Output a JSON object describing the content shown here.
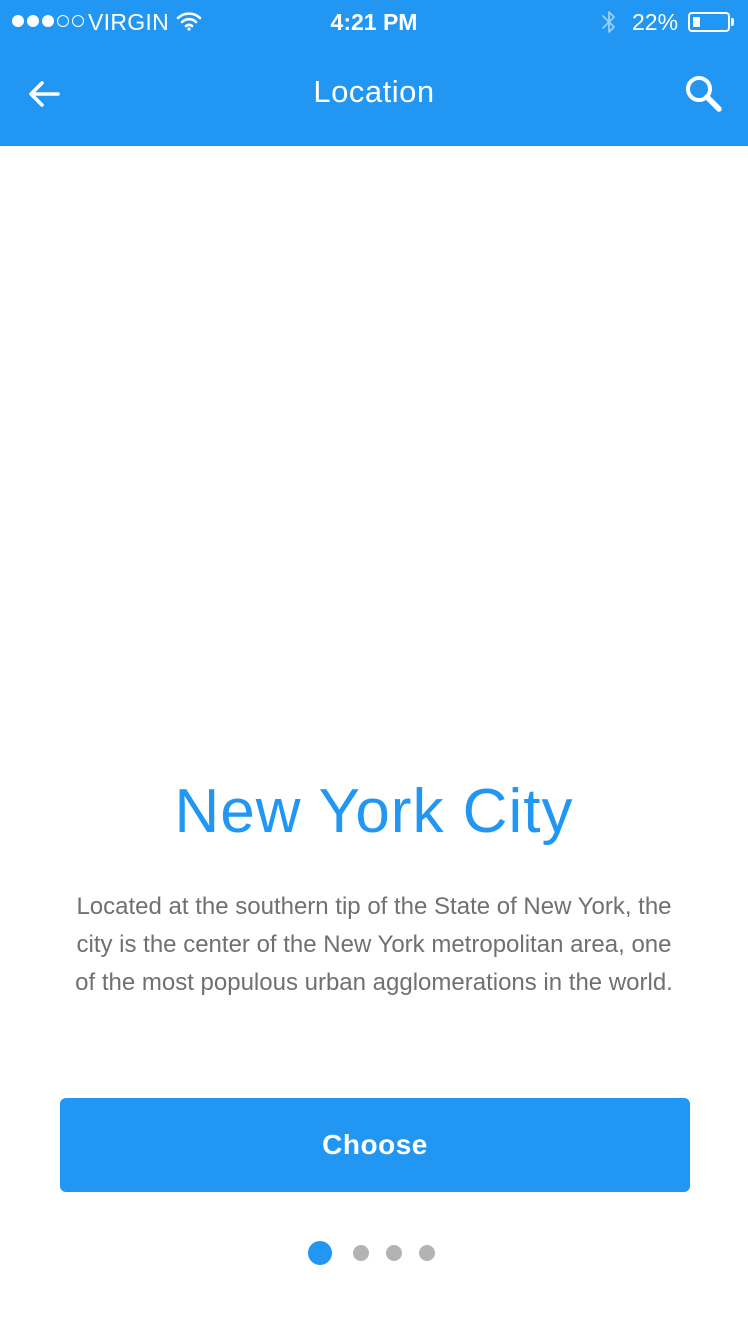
{
  "status_bar": {
    "carrier": "VIRGIN",
    "time": "4:21 PM",
    "battery_percent": "22%",
    "battery_level": 0.22,
    "signal_bars_filled": 3,
    "signal_bars_total": 5,
    "icons": [
      "wifi-icon",
      "bluetooth-icon",
      "battery-icon"
    ]
  },
  "nav": {
    "title": "Location",
    "back_icon": "arrow-left-icon",
    "search_icon": "search-icon"
  },
  "location": {
    "name": "New York City",
    "description": "Located at the southern tip of the State of New York, the city is the center of the New York metropolitan area, one of the most populous urban agglomerations in the world."
  },
  "actions": {
    "choose_label": "Choose"
  },
  "pager": {
    "total_pages": 4,
    "current_page": 1
  },
  "colors": {
    "accent": "#2196F3",
    "text_muted": "#707070",
    "inactive_dot": "#b3b3b3",
    "background": "#ffffff"
  }
}
